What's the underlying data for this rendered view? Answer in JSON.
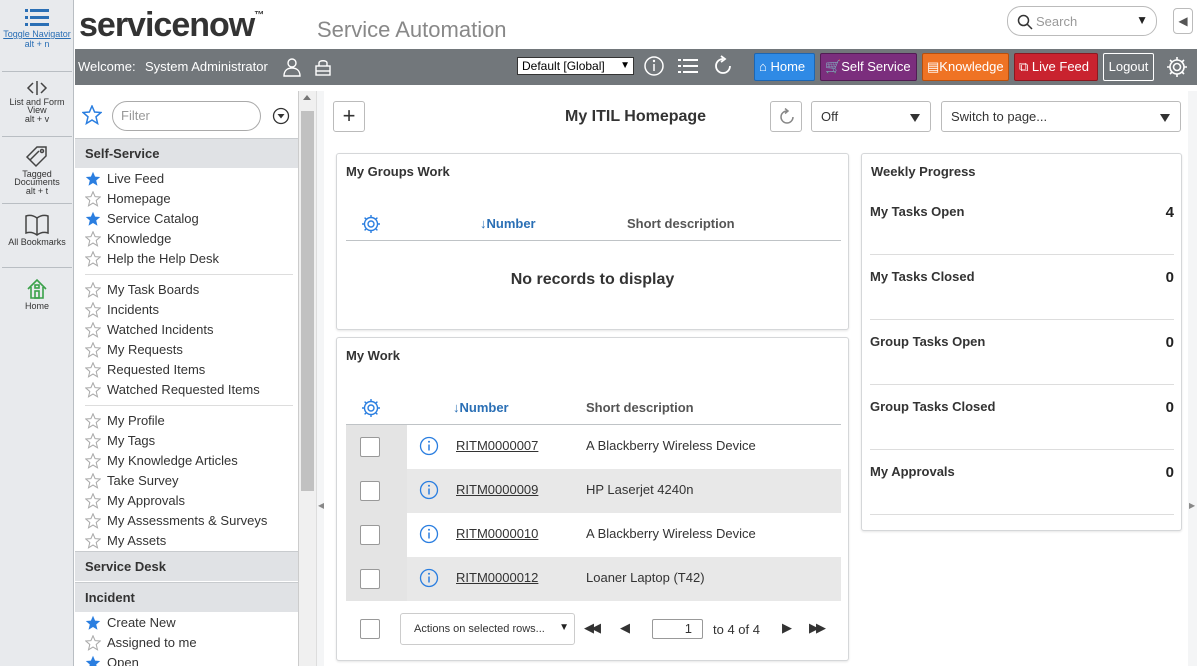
{
  "rail": {
    "toggle_navigator": {
      "label": "Toggle Navigator",
      "shortcut": "alt + n",
      "icon": "list-icon"
    },
    "list_form_view": {
      "label": "List and Form View",
      "shortcut": "alt + v",
      "icon": "split-view-icon"
    },
    "tagged_documents": {
      "label": "Tagged Documents",
      "shortcut": "alt + t",
      "icon": "tag-icon"
    },
    "all_bookmarks": {
      "label": "All Bookmarks",
      "icon": "book-icon"
    },
    "home": {
      "label": "Home",
      "icon": "home-icon"
    }
  },
  "header": {
    "logo_text_a": "service",
    "logo_text_b": "now",
    "logo_tm": "™",
    "app_title": "Service Automation",
    "search_placeholder": "Search"
  },
  "banner": {
    "welcome_label": "Welcome:",
    "user_name": "System Administrator",
    "domain_value": "Default [Global]",
    "buttons": {
      "home": "Home",
      "self_service": "Self Service",
      "knowledge": "Knowledge",
      "live_feed": "Live Feed",
      "logout": "Logout"
    },
    "colors": {
      "bar": "#72777b",
      "home": "#2f8ae5",
      "self_service": "#7b2e7d",
      "knowledge": "#ef7324",
      "live_feed": "#c9232f"
    }
  },
  "nav": {
    "filter_placeholder": "Filter",
    "sections": {
      "self_service": "Self-Service",
      "service_desk": "Service Desk",
      "incident": "Incident"
    },
    "self_service_items": [
      {
        "label": "Live Feed",
        "starred": true
      },
      {
        "label": "Homepage",
        "starred": false
      },
      {
        "label": "Service Catalog",
        "starred": true
      },
      {
        "label": "Knowledge",
        "starred": false
      },
      {
        "label": "Help the Help Desk",
        "starred": false
      },
      {
        "label": "My Task Boards",
        "starred": false
      },
      {
        "label": "Incidents",
        "starred": false
      },
      {
        "label": "Watched Incidents",
        "starred": false
      },
      {
        "label": "My Requests",
        "starred": false
      },
      {
        "label": "Requested Items",
        "starred": false
      },
      {
        "label": "Watched Requested Items",
        "starred": false
      },
      {
        "label": "My Profile",
        "starred": false
      },
      {
        "label": "My Tags",
        "starred": false
      },
      {
        "label": "My Knowledge Articles",
        "starred": false
      },
      {
        "label": "Take Survey",
        "starred": false
      },
      {
        "label": "My Approvals",
        "starred": false
      },
      {
        "label": "My Assessments & Surveys",
        "starred": false
      },
      {
        "label": "My Assets",
        "starred": false
      }
    ],
    "incident_items": [
      {
        "label": "Create New",
        "starred": true
      },
      {
        "label": "Assigned to me",
        "starred": false
      },
      {
        "label": "Open",
        "starred": true
      }
    ]
  },
  "content": {
    "page_title": "My ITIL Homepage",
    "refresh_value": "Off",
    "switch_page_placeholder": "Switch to page...",
    "groups_work": {
      "title": "My Groups Work",
      "col_number": "Number",
      "col_desc": "Short description",
      "empty": "No records to display"
    },
    "my_work": {
      "title": "My Work",
      "col_number": "Number",
      "col_desc": "Short description",
      "rows": [
        {
          "number": "RITM0000007",
          "desc": "A Blackberry Wireless Device"
        },
        {
          "number": "RITM0000009",
          "desc": "HP Laserjet 4240n"
        },
        {
          "number": "RITM0000010",
          "desc": "A Blackberry Wireless Device"
        },
        {
          "number": "RITM0000012",
          "desc": "Loaner Laptop (T42)"
        }
      ],
      "actions_label": "Actions on selected rows...",
      "page_value": "1",
      "page_of": "to 4 of 4"
    },
    "weekly": {
      "title": "Weekly Progress",
      "rows": [
        {
          "label": "My Tasks Open",
          "value": "4"
        },
        {
          "label": "My Tasks Closed",
          "value": "0"
        },
        {
          "label": "Group Tasks Open",
          "value": "0"
        },
        {
          "label": "Group Tasks Closed",
          "value": "0"
        },
        {
          "label": "My Approvals",
          "value": "0"
        }
      ]
    }
  }
}
